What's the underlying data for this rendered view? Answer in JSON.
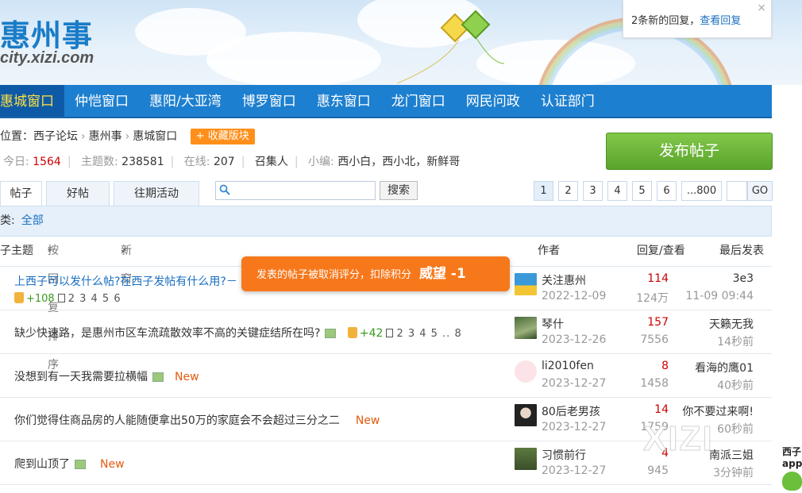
{
  "header": {
    "logo_cn": "惠州事",
    "logo_en": "city.xizi.com",
    "notice_text": "2条新的回复，",
    "notice_link": "查看回复",
    "notice_close": "×"
  },
  "nav": [
    "惠城窗口",
    "仲恺窗口",
    "惠阳/大亚湾",
    "博罗窗口",
    "惠东窗口",
    "龙门窗口",
    "网民问政",
    "认证部门"
  ],
  "breadcrumb": {
    "prefix": "位置：",
    "items": [
      "西子论坛",
      "惠州事",
      "惠城窗口"
    ],
    "sep": "›",
    "fav_label": "+ 收藏版块"
  },
  "stats": {
    "today_label": "今日:",
    "today": "1564",
    "topics_label": "主题数:",
    "topics": "238581",
    "online_label": "在线:",
    "online": "207",
    "convener": "召集人",
    "editor_label": "小编:",
    "editors": "西小白，西小北，新鲜哥"
  },
  "post_button": "发布帖子",
  "tabs": [
    "帖子",
    "好帖",
    "往期活动"
  ],
  "search": {
    "placeholder": "",
    "button": "搜索"
  },
  "pager": [
    "1",
    "2",
    "3",
    "4",
    "5",
    "6",
    "...800"
  ],
  "pager_go": "GO",
  "category": {
    "label": "类:",
    "all": "全部"
  },
  "table_header": {
    "subject": "子主题",
    "sort": "按回复排序",
    "sort_arrow": "▾",
    "new_window": "新窗",
    "checkbox": "✔",
    "author": "作者",
    "reply_view": "回复/查看",
    "last_post": "最后发表"
  },
  "toast": {
    "text": "发表的帖子被取消评分，扣除积分",
    "big": "威望 -1"
  },
  "threads": [
    {
      "title": "上西子可以发什么帖?在西子发帖有什么用?－",
      "praise": "+108",
      "pages": "2 3 4 5 6",
      "author": "关注惠州",
      "date": "2022-12-09",
      "replies": "114",
      "views": "124万",
      "last_user": "3e3",
      "last_time": "11-09 09:44"
    },
    {
      "title": "缺少快速路，是惠州市区车流疏散效率不高的关键症结所在吗?",
      "praise": "+42",
      "pages": "2 3 4 5 .. 8",
      "author": "琴什",
      "date": "2023-12-26",
      "replies": "157",
      "views": "7556",
      "last_user": "天籁无我",
      "last_time": "14秒前"
    },
    {
      "title": "没想到有一天我需要拉横幅",
      "new": "New",
      "author": "li2010fen",
      "date": "2023-12-27",
      "replies": "8",
      "views": "1458",
      "last_user": "看海的鹰01",
      "last_time": "40秒前"
    },
    {
      "title": "你们觉得住商品房的人能随便拿出50万的家庭会不会超过三分之二",
      "new": "New",
      "author": "80后老男孩",
      "date": "2023-12-27",
      "replies": "14",
      "views": "1759",
      "last_user": "你不要过来啊!",
      "last_time": "60秒前"
    },
    {
      "title": "爬到山顶了",
      "new": "New",
      "author": "习惯前行",
      "date": "2023-12-27",
      "replies": "4",
      "views": "945",
      "last_user": "南派三姐",
      "last_time": "3分钟前"
    }
  ],
  "watermark": "XIZI",
  "app_badge": {
    "line1": "西子",
    "line2": "app"
  },
  "colors": {
    "nav": "#1d7fcf",
    "accent": "#ff8f1a",
    "post_button": "#6cb53a",
    "link": "#1a6fc0",
    "red": "#cc0000"
  }
}
